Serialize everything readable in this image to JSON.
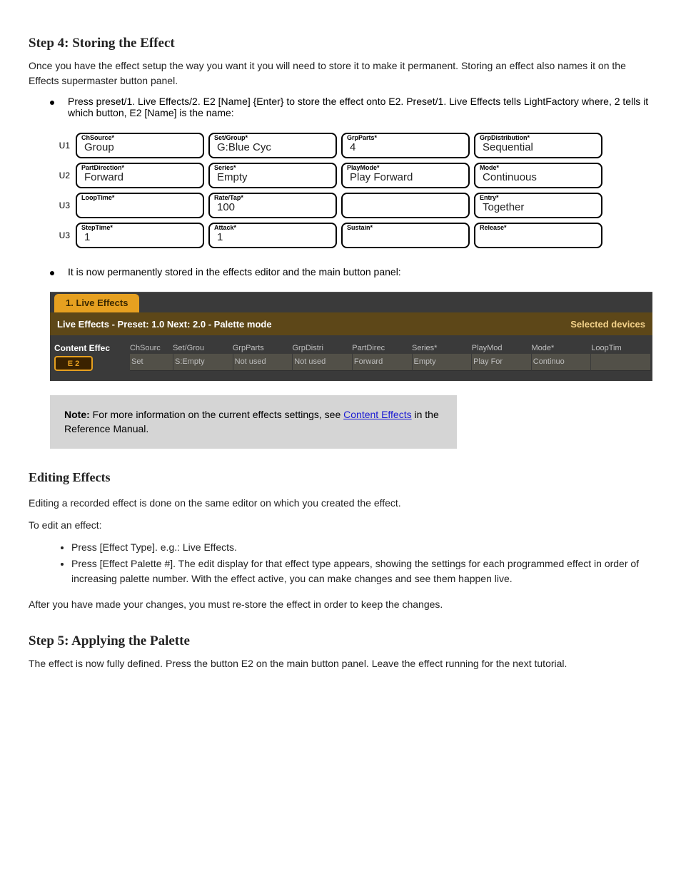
{
  "header": "Step 4: Storing the Effect",
  "intro": "Once you have the effect setup the way you want it you will need to store it to make it permanent. Storing an effect also names it on the Effects supermaster button panel.",
  "bullets1": "Press preset/1. Live Effects/2. E2 [Name] {Enter} to store the effect onto E2. Preset/1. Live Effects tells LightFactory where, 2 tells it which button, E2 [Name] is the name:",
  "param_rows": [
    {
      "row": "U1",
      "cells": [
        {
          "cap": "ChSource*",
          "val": "Group"
        },
        {
          "cap": "Set/Group*",
          "val": "G:Blue Cyc"
        },
        {
          "cap": "GrpParts*",
          "val": "4"
        },
        {
          "cap": "GrpDistribution*",
          "val": "Sequential"
        }
      ]
    },
    {
      "row": "U2",
      "cells": [
        {
          "cap": "PartDirection*",
          "val": "Forward"
        },
        {
          "cap": "Series*",
          "val": "Empty"
        },
        {
          "cap": "PlayMode*",
          "val": "Play Forward"
        },
        {
          "cap": "Mode*",
          "val": "Continuous"
        }
      ]
    },
    {
      "row": "U3",
      "cells": [
        {
          "cap": "LoopTime*",
          "val": ""
        },
        {
          "cap": "Rate/Tap*",
          "val": "100"
        },
        {
          "cap": "",
          "val": "",
          "empty": true
        },
        {
          "cap": "Entry*",
          "val": "Together"
        }
      ]
    },
    {
      "row": "U3",
      "cells": [
        {
          "cap": "StepTime*",
          "val": "1"
        },
        {
          "cap": "Attack*",
          "val": "1"
        },
        {
          "cap": "Sustain*",
          "val": ""
        },
        {
          "cap": "Release*",
          "val": ""
        }
      ]
    }
  ],
  "bullets2": "It is now permanently stored in the effects editor and the main button panel:",
  "panel": {
    "tab": "1. Live Effects",
    "title_left": "Live Effects - Preset: 1.0 Next: 2.0 - Palette mode",
    "title_right": "Selected devices",
    "lead": "Content Effec",
    "pill": "E 2",
    "cols": [
      "ChSourc",
      "Set/Grou",
      "GrpParts",
      "GrpDistri",
      "PartDirec",
      "Series*",
      "PlayMod",
      "Mode*",
      "LoopTim"
    ],
    "vals": [
      "Set",
      "S:Empty",
      "Not used",
      "Not used",
      "Forward",
      "Empty",
      "Play For",
      "Continuo",
      ""
    ]
  },
  "note": {
    "title": "Note:",
    "body_before": " For more information on the current effects settings, see ",
    "link": "Content Effects",
    "body_after": " in the Reference Manual."
  },
  "edit": {
    "heading": "Editing Effects",
    "p1": "Editing a recorded effect is done on the same editor on which you created the effect.",
    "p2": "To edit an effect:",
    "li1": "Press [Effect Type]. e.g.: Live Effects.",
    "li2": "Press [Effect Palette #]. The edit display for that effect type appears, showing the settings for each programmed effect in order of increasing palette number. With the effect active, you can make changes and see them happen live.",
    "p3": "After you have made your changes, you must re-store the effect in order to keep the changes.",
    "step5": "Step 5: Applying the Palette",
    "p4": "The effect is now fully defined. Press the button E2 on the main button panel. Leave the effect running for the next tutorial."
  }
}
